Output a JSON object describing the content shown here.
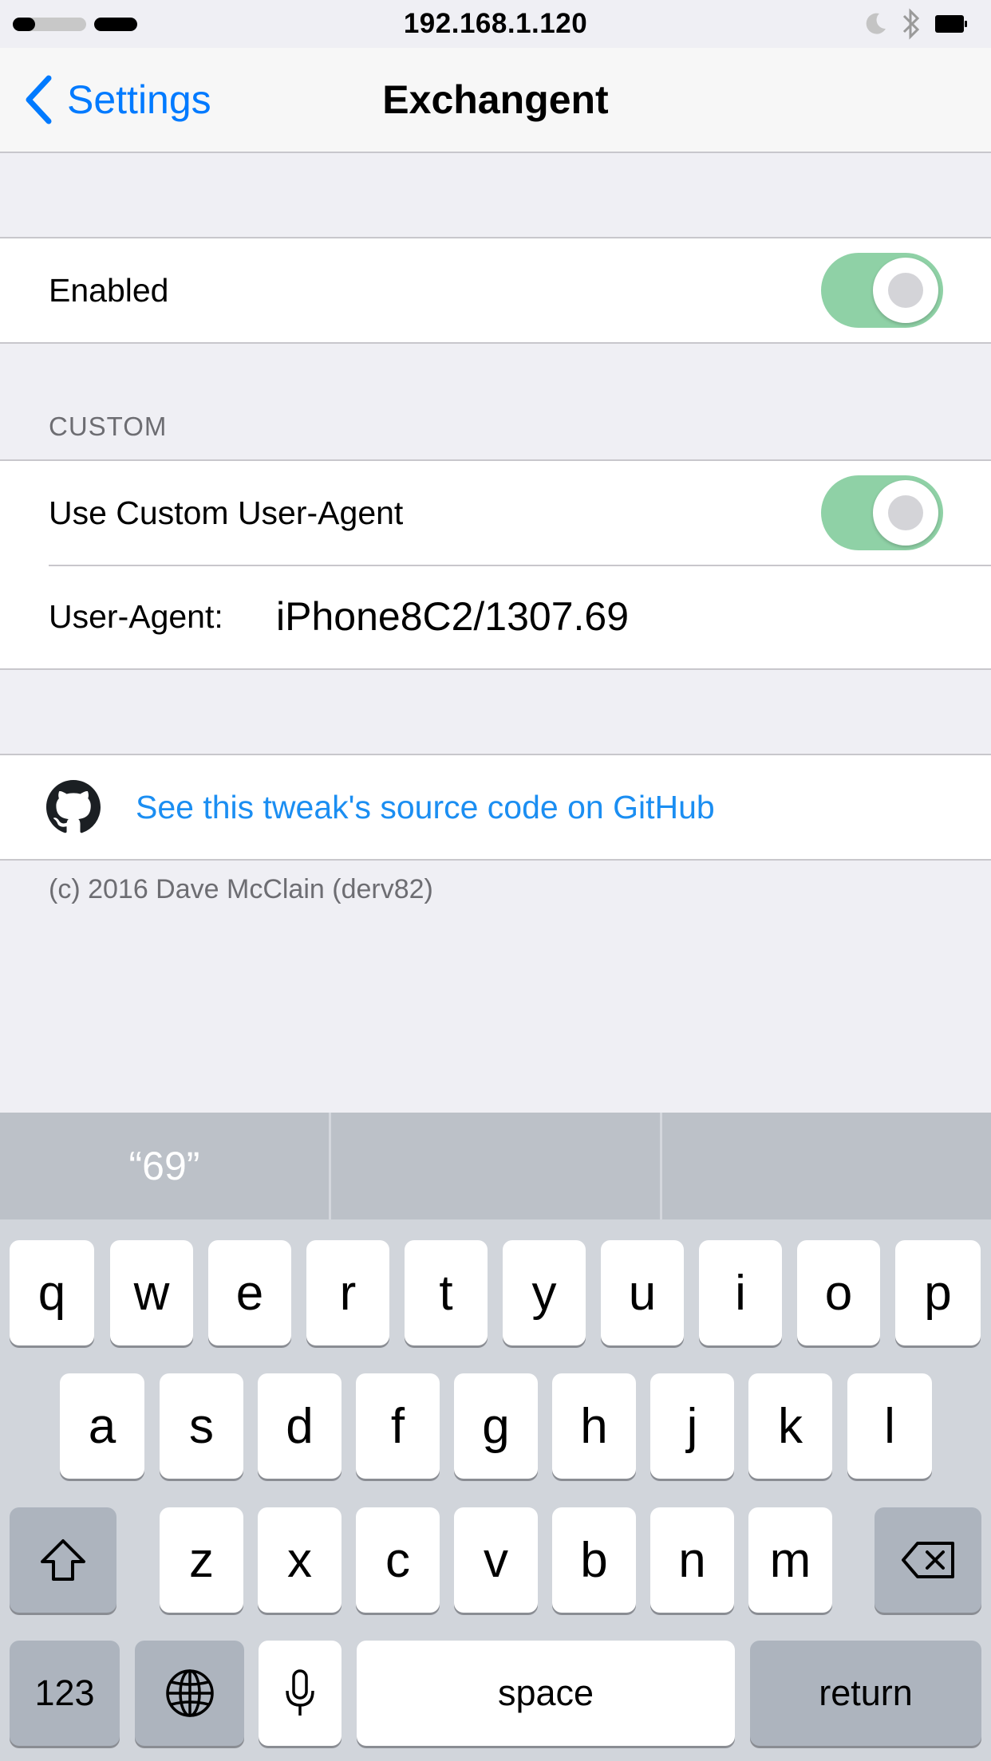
{
  "status_bar": {
    "center_text": "192.168.1.120"
  },
  "nav": {
    "back_label": "Settings",
    "title": "Exchangent"
  },
  "main": {
    "enabled_label": "Enabled",
    "enabled_on": true,
    "custom_header": "CUSTOM",
    "use_custom_ua_label": "Use Custom User-Agent",
    "use_custom_ua_on": true,
    "user_agent_label": "User-Agent:",
    "user_agent_value": "iPhone8C2/1307.69",
    "github_link_label": "See this tweak's source code on GitHub",
    "footer": "(c) 2016 Dave McClain (derv82)"
  },
  "keyboard": {
    "predictions": [
      "“69”",
      "",
      ""
    ],
    "row1": [
      "q",
      "w",
      "e",
      "r",
      "t",
      "y",
      "u",
      "i",
      "o",
      "p"
    ],
    "row2": [
      "a",
      "s",
      "d",
      "f",
      "g",
      "h",
      "j",
      "k",
      "l"
    ],
    "row3": [
      "z",
      "x",
      "c",
      "v",
      "b",
      "n",
      "m"
    ],
    "numbers_label": "123",
    "space_label": "space",
    "return_label": "return"
  },
  "colors": {
    "accent": "#007aff",
    "toggle_on": "#8fd1a6",
    "link": "#1b8ef2"
  }
}
